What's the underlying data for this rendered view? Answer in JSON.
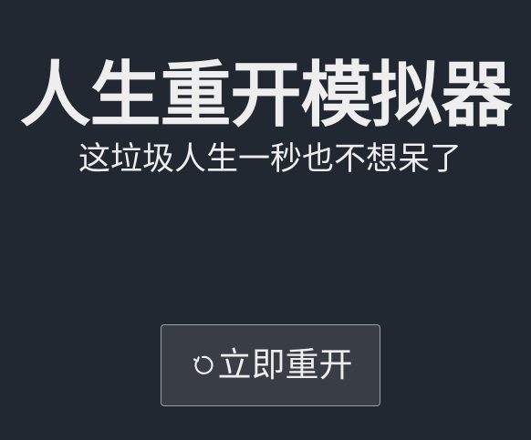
{
  "header": {
    "title": "人生重开模拟器",
    "subtitle": "这垃圾人生一秒也不想呆了"
  },
  "actions": {
    "restart_label": "立即重开",
    "restart_icon": "rotate-ccw-icon"
  },
  "colors": {
    "background": "#222831",
    "text": "#eeeeee",
    "button_background": "#393e46",
    "button_border": "#9aa0a8"
  }
}
